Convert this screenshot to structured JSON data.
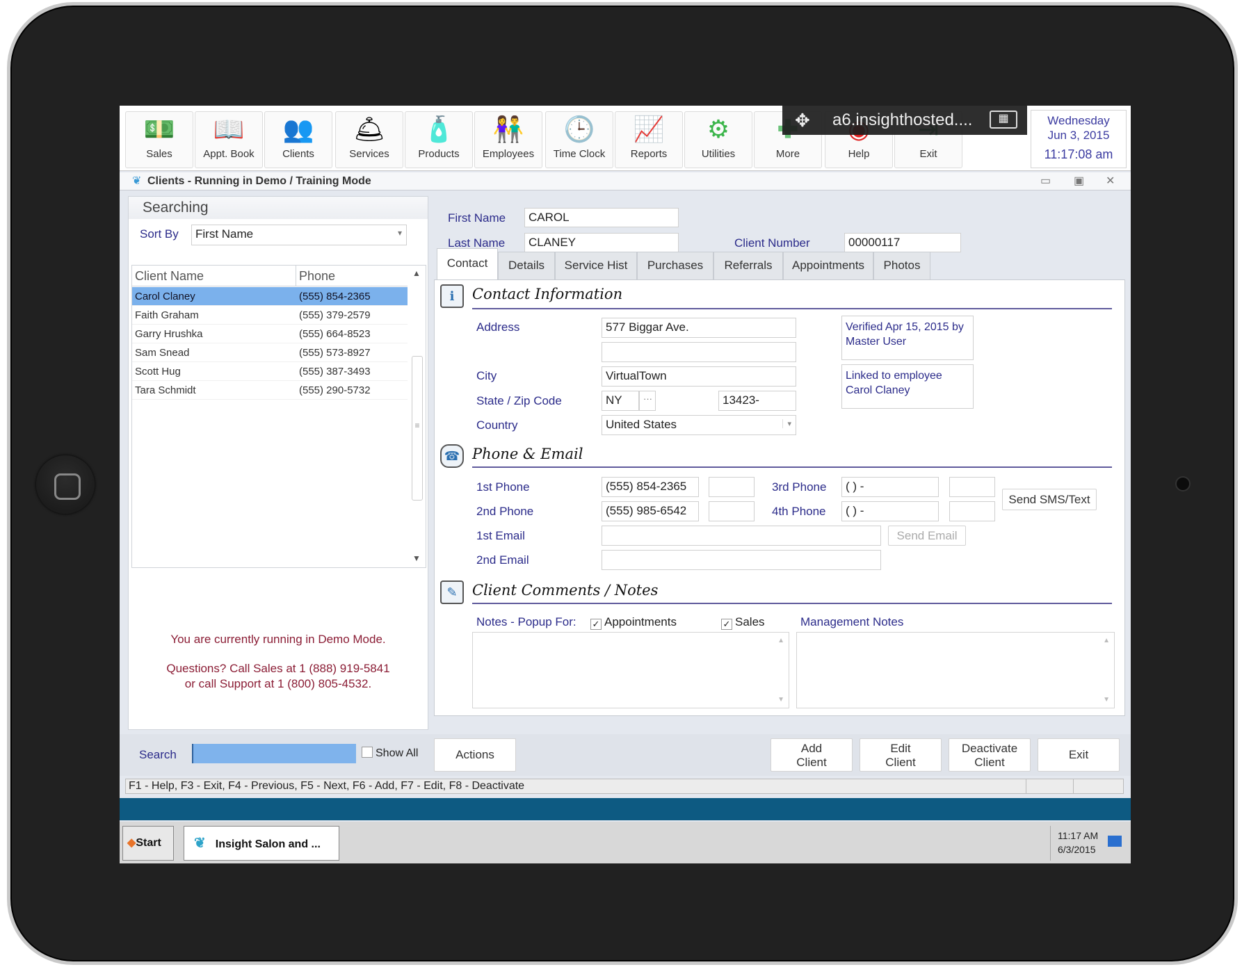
{
  "toolbar": {
    "items": [
      {
        "label": "Sales",
        "icon": "money-hand-icon"
      },
      {
        "label": "Appt. Book",
        "icon": "book-icon"
      },
      {
        "label": "Clients",
        "icon": "people-icon"
      },
      {
        "label": "Services",
        "icon": "service-bell-icon"
      },
      {
        "label": "Products",
        "icon": "bottles-icon"
      },
      {
        "label": "Employees",
        "icon": "employees-icon"
      },
      {
        "label": "Time Clock",
        "icon": "clock-icon"
      },
      {
        "label": "Reports",
        "icon": "chart-icon"
      },
      {
        "label": "Utilities",
        "icon": "gears-icon"
      },
      {
        "label": "More",
        "icon": "plus-icon"
      },
      {
        "label": "Help",
        "icon": "lifebuoy-icon"
      },
      {
        "label": "Exit",
        "icon": "exit-door-icon"
      }
    ],
    "date": {
      "weekday": "Wednesday",
      "date": "Jun 3, 2015",
      "time": "11:17:08 am"
    }
  },
  "remote_overlay": {
    "host": "a6.insighthosted....",
    "move_icon": "✥",
    "keyboard_icon": "⌨"
  },
  "window": {
    "title": "Clients - Running in Demo / Training Mode"
  },
  "left_panel": {
    "header": "Searching",
    "sort_by_label": "Sort By",
    "sort_by_value": "First Name",
    "columns": [
      "Client Name",
      "Phone"
    ],
    "clients": [
      {
        "name": "Carol Claney",
        "phone": "(555) 854-2365",
        "selected": true
      },
      {
        "name": "Faith Graham",
        "phone": "(555) 379-2579"
      },
      {
        "name": "Garry Hrushka",
        "phone": "(555) 664-8523"
      },
      {
        "name": "Sam Snead",
        "phone": "(555) 573-8927"
      },
      {
        "name": "Scott Hug",
        "phone": "(555) 387-3493"
      },
      {
        "name": "Tara Schmidt",
        "phone": "(555) 290-5732"
      }
    ],
    "demo_line1": "You are currently running in Demo Mode.",
    "demo_line2": "Questions? Call Sales at 1 (888) 919-5841",
    "demo_line3": "or call Support at 1 (800) 805-4532."
  },
  "client": {
    "first_name_label": "First Name",
    "first_name": "CAROL",
    "last_name_label": "Last Name",
    "last_name": "CLANEY",
    "client_number_label": "Client Number",
    "client_number": "00000117"
  },
  "tabs": [
    "Contact",
    "Details",
    "Service Hist",
    "Purchases",
    "Referrals",
    "Appointments",
    "Photos"
  ],
  "contact": {
    "section_title": "Contact Information",
    "address_label": "Address",
    "address1": "577 Biggar Ave.",
    "address2": "",
    "city_label": "City",
    "city": "VirtualTown",
    "state_zip_label": "State / Zip Code",
    "state": "NY",
    "state_more": "···",
    "zip": "13423-",
    "country_label": "Country",
    "country": "United States",
    "verified": "Verified Apr 15, 2015 by Master User",
    "linked": "Linked to employee Carol Claney"
  },
  "phone_email": {
    "section_title": "Phone & Email",
    "phone1_label": "1st Phone",
    "phone1": "(555) 854-2365",
    "phone1_ext": "",
    "phone2_label": "2nd Phone",
    "phone2": "(555) 985-6542",
    "phone2_ext": "",
    "phone3_label": "3rd Phone",
    "phone3": "(  )   -",
    "phone3_ext": "",
    "phone4_label": "4th Phone",
    "phone4": "(  )   -",
    "phone4_ext": "",
    "email1_label": "1st Email",
    "email1": "",
    "email2_label": "2nd Email",
    "email2": "",
    "send_sms": "Send SMS/Text",
    "send_email": "Send Email"
  },
  "notes": {
    "section_title": "Client Comments / Notes",
    "popup_label": "Notes - Popup For:",
    "appointments_label": "Appointments",
    "appointments_checked": true,
    "sales_label": "Sales",
    "sales_checked": true,
    "management_label": "Management Notes",
    "notes_text": "",
    "management_text": ""
  },
  "bottom": {
    "search_label": "Search",
    "search_value": "",
    "show_all_label": "Show All",
    "actions": "Actions",
    "add_client": [
      "Add",
      "Client"
    ],
    "edit_client": [
      "Edit",
      "Client"
    ],
    "deactivate_client": [
      "Deactivate",
      "Client"
    ],
    "exit": "Exit",
    "status": "F1 - Help, F3 - Exit, F4 - Previous, F5 - Next, F6 - Add, F7 - Edit, F8 - Deactivate"
  },
  "taskbar": {
    "start": "Start",
    "app": "Insight Salon and ...",
    "clock_time": "11:17 AM",
    "clock_date": "6/3/2015"
  }
}
